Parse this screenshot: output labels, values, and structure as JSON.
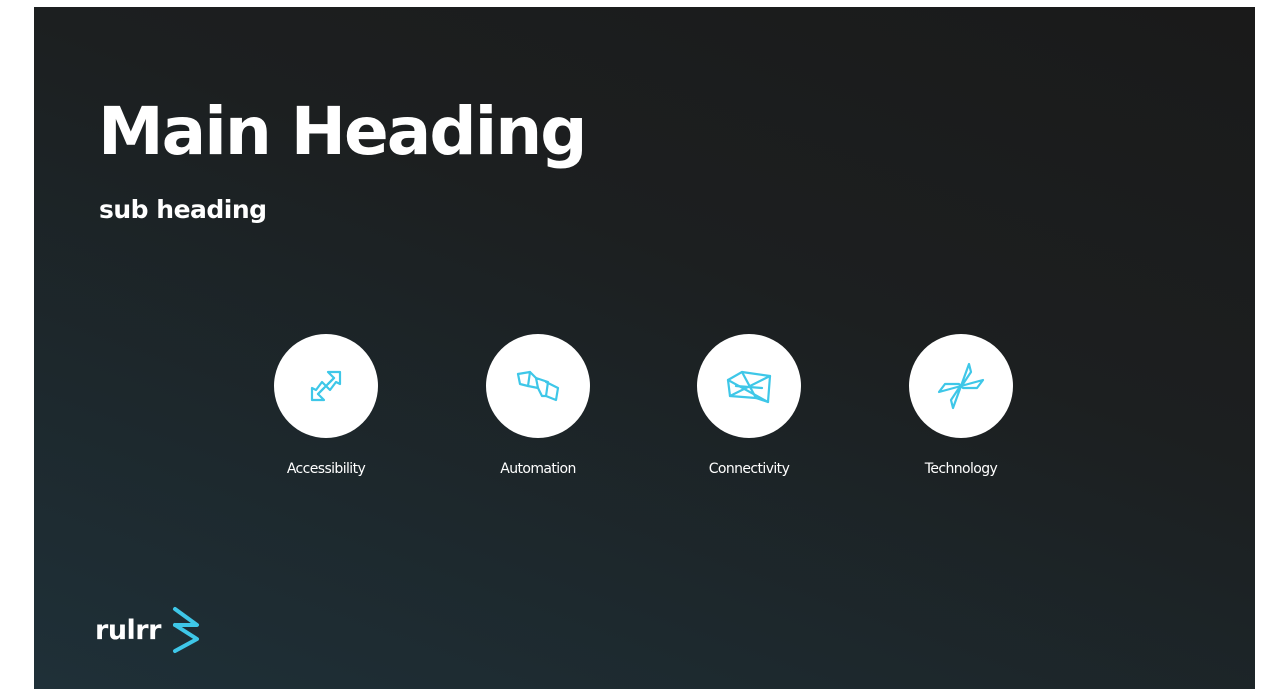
{
  "slide": {
    "title": "Main Heading",
    "subtitle": "sub heading"
  },
  "features": [
    {
      "label": "Accessibility",
      "icon": "accessibility-icon"
    },
    {
      "label": "Automation",
      "icon": "automation-icon"
    },
    {
      "label": "Connectivity",
      "icon": "connectivity-icon"
    },
    {
      "label": "Technology",
      "icon": "technology-icon"
    }
  ],
  "brand": {
    "name": "rulrr",
    "logo_icon": "chevron-logo-icon",
    "accent_color": "#3ec7e8"
  }
}
